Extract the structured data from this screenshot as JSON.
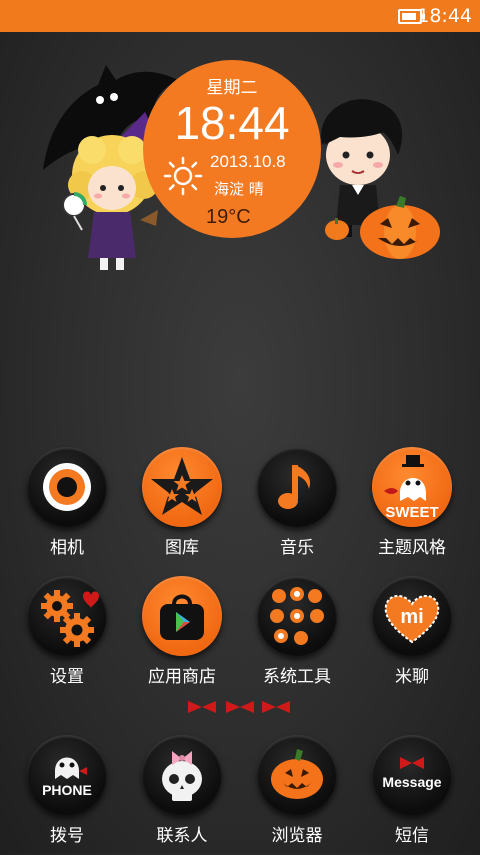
{
  "status_bar": {
    "time": "18:44",
    "battery_icon": "battery-icon"
  },
  "widget": {
    "weekday": "星期二",
    "time": "18:44",
    "date": "2013.10.8",
    "location_weather": "海淀 晴",
    "temperature": "19°C",
    "weather_icon": "sun-icon"
  },
  "apps": {
    "row1": [
      {
        "label": "相机",
        "icon": "camera-icon"
      },
      {
        "label": "图库",
        "icon": "gallery-star-icon"
      },
      {
        "label": "音乐",
        "icon": "music-note-icon"
      },
      {
        "label": "主题风格",
        "icon": "theme-ghost-icon"
      }
    ],
    "row2": [
      {
        "label": "设置",
        "icon": "settings-gear-icon"
      },
      {
        "label": "应用商店",
        "icon": "app-store-bag-icon"
      },
      {
        "label": "系统工具",
        "icon": "system-tools-folder-icon"
      },
      {
        "label": "米聊",
        "icon": "miliao-heart-icon"
      }
    ],
    "dock": [
      {
        "label": "拨号",
        "icon": "phone-icon"
      },
      {
        "label": "联系人",
        "icon": "contacts-skull-icon"
      },
      {
        "label": "浏览器",
        "icon": "browser-pumpkin-icon"
      },
      {
        "label": "短信",
        "icon": "message-icon"
      }
    ]
  },
  "icon_text": {
    "sweet": "SWEET",
    "mi": "mi",
    "phone": "PHONE",
    "message": "Message"
  },
  "colors": {
    "accent": "#f47a22",
    "background": "#2d2d2d",
    "status_bar": "#f07a1c"
  }
}
